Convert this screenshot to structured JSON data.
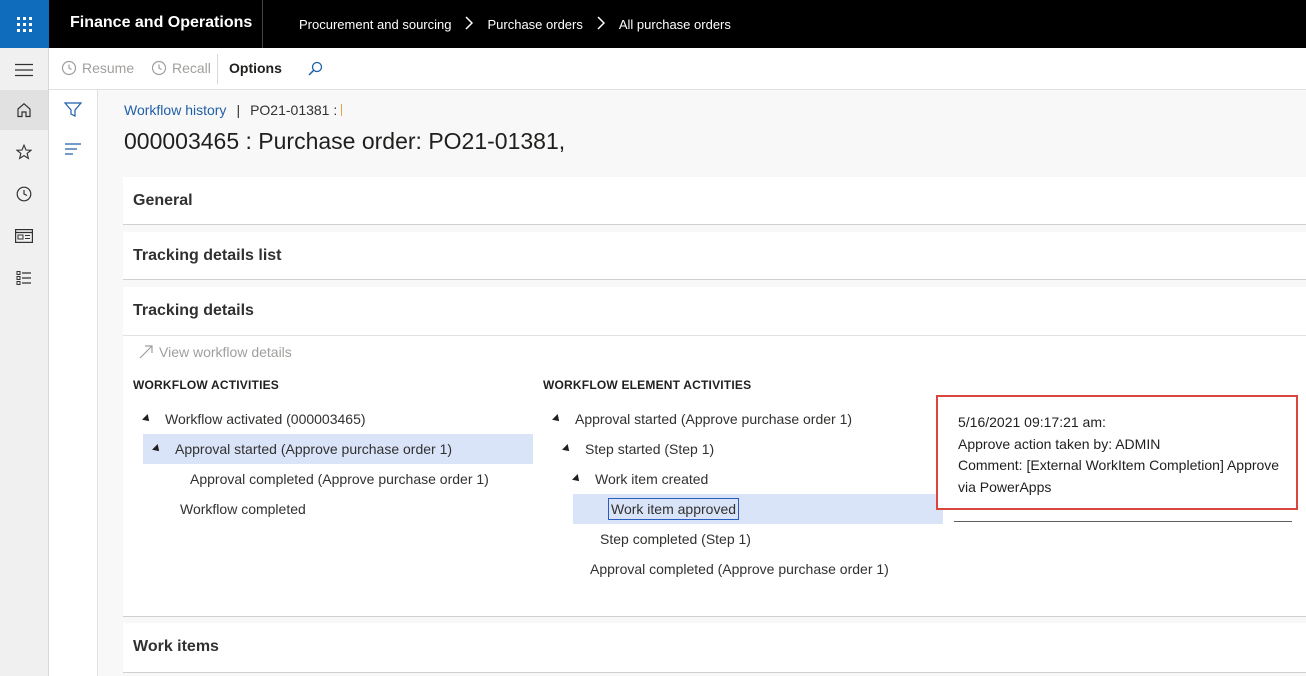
{
  "topbar": {
    "app_title": "Finance and Operations",
    "breadcrumb": [
      "Procurement and sourcing",
      "Purchase orders",
      "All purchase orders"
    ]
  },
  "navrail": {
    "items": [
      "menu-icon",
      "home-icon",
      "star-icon",
      "clock-icon",
      "workspace-icon",
      "list-icon"
    ]
  },
  "actionpane": {
    "resume_label": "Resume",
    "recall_label": "Recall",
    "options_label": "Options",
    "search_icon": "search-icon"
  },
  "page": {
    "crumb_link": "Workflow history",
    "crumb_record": "PO21-01381 :",
    "title": "000003465 : Purchase order: PO21-01381,"
  },
  "sections": {
    "general": "General",
    "tracking_list": "Tracking details list",
    "tracking_details": "Tracking details",
    "work_items": "Work items"
  },
  "tracking": {
    "view_workflow_details": "View workflow details",
    "workflow_activities_header": "WORKFLOW ACTIVITIES",
    "workflow_activities": [
      "Workflow activated (000003465)",
      "Approval started (Approve purchase order 1)",
      "Approval completed (Approve purchase order 1)",
      "Workflow completed"
    ],
    "element_activities_header": "WORKFLOW ELEMENT ACTIVITIES",
    "element_activities": [
      "Approval started (Approve purchase order 1)",
      "Step started (Step 1)",
      "Work item created",
      "Work item approved",
      "Step completed (Step 1)",
      "Approval completed (Approve purchase order 1)"
    ],
    "details": {
      "timestamp": "5/16/2021 09:17:21 am:",
      "action": "Approve action taken by: ADMIN",
      "comment": "Comment: [External WorkItem Completion] Approve via PowerApps"
    }
  },
  "colors": {
    "brand_blue": "#0f6cbd",
    "selection": "#d9e4f9",
    "highlight_box": "#d9463d"
  }
}
